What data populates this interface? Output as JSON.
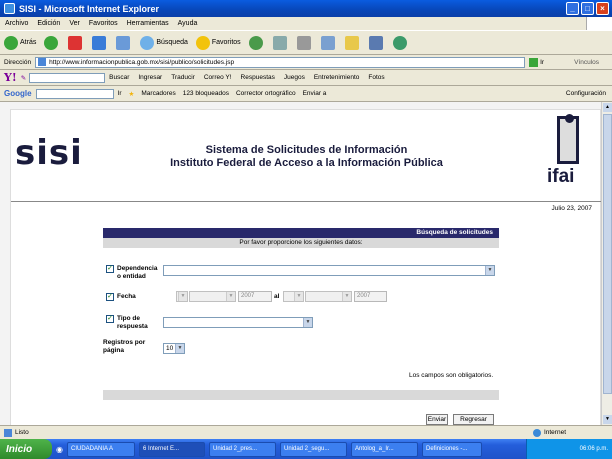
{
  "window": {
    "title": "SISI - Microsoft Internet Explorer"
  },
  "menu": [
    "Archivo",
    "Edición",
    "Ver",
    "Favoritos",
    "Herramientas",
    "Ayuda"
  ],
  "toolbar": {
    "back": "Atrás",
    "search": "Búsqueda",
    "favorites": "Favoritos"
  },
  "address": {
    "label": "Dirección",
    "url": "http://www.informacionpublica.gob.mx/sisi/publico/solicitudes.jsp",
    "go": "Ir",
    "links": "Vínculos"
  },
  "yahoo": {
    "search": "Buscar",
    "items": [
      "Ingresar",
      "Traducir",
      "Correo Y!",
      "Respuestas",
      "Juegos",
      "Entretenimiento",
      "Fotos"
    ]
  },
  "google": {
    "logo": "Google",
    "go": "Ir",
    "items": [
      "Marcadores",
      "123 bloqueados",
      "Corrector ortográfico",
      "Enviar a"
    ],
    "config": "Configuración"
  },
  "header": {
    "logo_text": "sisi",
    "title_line1": "Sistema de Solicitudes de Información",
    "title_line2": "Instituto Federal de Acceso a la Información Pública",
    "right_logo": "ifai",
    "date": "Julio 23, 2007"
  },
  "form": {
    "title": "Búsqueda de solicitudes",
    "subtitle": "Por favor proporcione los siguientes datos:",
    "dependencia_label": "Dependencia o entidad",
    "fecha_label": "Fecha",
    "fecha_year_from": "2007",
    "fecha_to": "al",
    "fecha_year_to": "2007",
    "tipo_label": "Tipo de respuesta",
    "registros_label": "Registros por página",
    "registros_value": "10",
    "required_note": "Los campos son obligatorios.",
    "send": "Enviar",
    "back": "Regresar"
  },
  "status": {
    "left": "Listo",
    "zone": "Internet"
  },
  "taskbar": {
    "start": "Inicio",
    "tasks": [
      "CIUDADANIA A",
      "6 Internet E...",
      "Unidad 2_pres...",
      "Unidad 2_segu...",
      "Antolog_a_Ir...",
      "Definiciones -..."
    ],
    "time": "06:06 p.m."
  }
}
